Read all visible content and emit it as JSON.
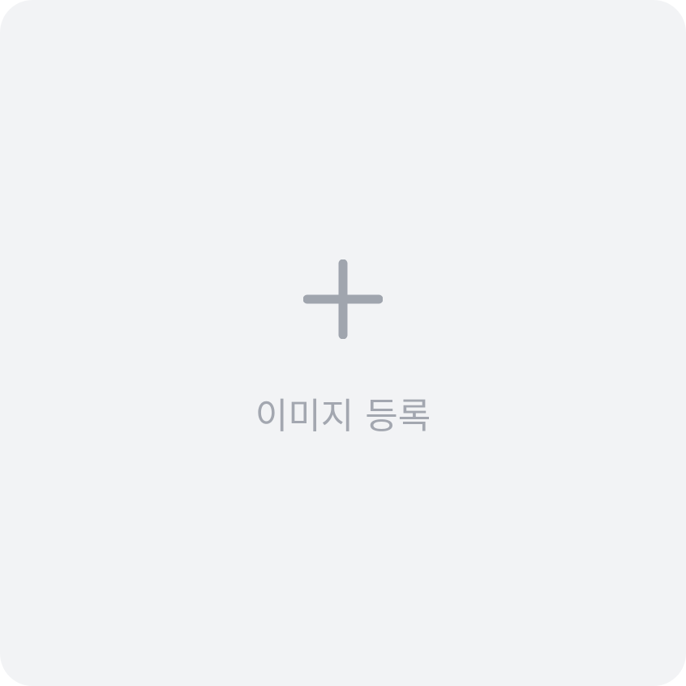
{
  "upload": {
    "label": "이미지 등록",
    "icon": "plus-icon"
  },
  "colors": {
    "tile_background": "#f2f3f5",
    "icon": "#a0a5ae",
    "label": "#a3a7b0"
  }
}
